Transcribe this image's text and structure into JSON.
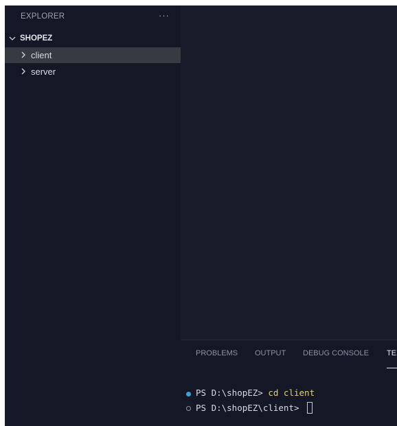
{
  "explorer": {
    "title": "EXPLORER",
    "more_icon": "ellipsis-icon",
    "root": {
      "label": "SHOPEZ",
      "icon": "chevron-down-icon"
    },
    "items": [
      {
        "label": "client",
        "icon": "chevron-right-icon",
        "selected": true
      },
      {
        "label": "server",
        "icon": "chevron-right-icon",
        "selected": false
      }
    ]
  },
  "panel": {
    "tabs": [
      {
        "label": "PROBLEMS",
        "active": false
      },
      {
        "label": "OUTPUT",
        "active": false
      },
      {
        "label": "DEBUG CONSOLE",
        "active": false
      },
      {
        "label": "TE",
        "active": true
      }
    ]
  },
  "terminal": {
    "lines": [
      {
        "prompt": "PS D:\\shopEZ> ",
        "command": "cd client",
        "marker": "filled"
      },
      {
        "prompt": "PS D:\\shopEZ\\client> ",
        "command": "",
        "marker": "hollow"
      }
    ]
  },
  "colors": {
    "sidebar_bg": "#141826",
    "editor_bg": "#181c2b",
    "selected_row": "#383a42",
    "command": "#e5d06b",
    "status_dot": "#3ea0d8"
  }
}
